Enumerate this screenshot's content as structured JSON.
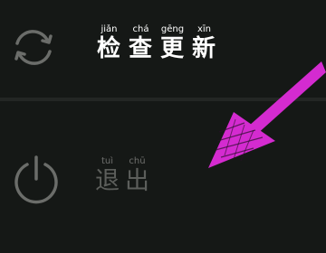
{
  "menu": {
    "update": {
      "icon": "refresh-icon",
      "chars": [
        {
          "pinyin": "jiǎn",
          "hanzi": "检"
        },
        {
          "pinyin": "chá",
          "hanzi": "查"
        },
        {
          "pinyin": "gēng",
          "hanzi": "更"
        },
        {
          "pinyin": "xīn",
          "hanzi": "新"
        }
      ]
    },
    "logout": {
      "icon": "power-icon",
      "chars": [
        {
          "pinyin": "tuì",
          "hanzi": "退"
        },
        {
          "pinyin": "chū",
          "hanzi": "出"
        }
      ]
    }
  },
  "annotation": {
    "icon": "arrow-pointer-icon",
    "color": "#d42bd0"
  },
  "colors": {
    "background": "#151816",
    "active_text": "#ffffff",
    "disabled_text": "#5c5e5b",
    "icon": "#6b6d6a"
  }
}
